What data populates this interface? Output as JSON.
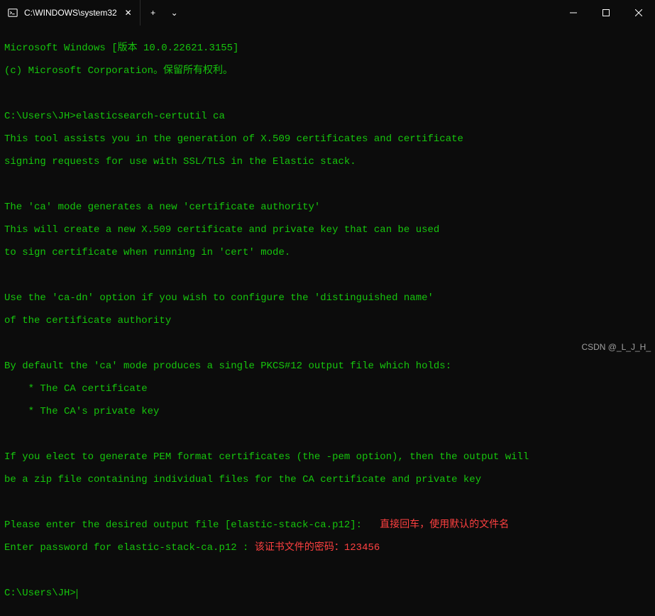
{
  "titlebar": {
    "tab_title": "C:\\WINDOWS\\system32",
    "close_glyph": "✕",
    "add_glyph": "+",
    "dropdown_glyph": "⌄"
  },
  "terminal": {
    "banner1": "Microsoft Windows [版本 10.0.22621.3155]",
    "banner2": "(c) Microsoft Corporation。保留所有权利。",
    "prompt1_prefix": "C:\\Users\\JH>",
    "prompt1_cmd": "elasticsearch-certutil ca",
    "out1": "This tool assists you in the generation of X.509 certificates and certificate",
    "out2": "signing requests for use with SSL/TLS in the Elastic stack.",
    "out3": "The 'ca' mode generates a new 'certificate authority'",
    "out4": "This will create a new X.509 certificate and private key that can be used",
    "out5": "to sign certificate when running in 'cert' mode.",
    "out6": "Use the 'ca-dn' option if you wish to configure the 'distinguished name'",
    "out7": "of the certificate authority",
    "out8": "By default the 'ca' mode produces a single PKCS#12 output file which holds:",
    "out9": "    * The CA certificate",
    "out10": "    * The CA's private key",
    "out11": "If you elect to generate PEM format certificates (the -pem option), then the output will",
    "out12": "be a zip file containing individual files for the CA certificate and private key",
    "prompt_file": "Please enter the desired output file [elastic-stack-ca.p12]: ",
    "anno_file": "  直接回车，使用默认的文件名",
    "prompt_pass": "Enter password for elastic-stack-ca.p12 : ",
    "anno_pass": "该证书文件的密码：123456",
    "prompt2_prefix": "C:\\Users\\JH>"
  },
  "watermark": "CSDN @_L_J_H_"
}
